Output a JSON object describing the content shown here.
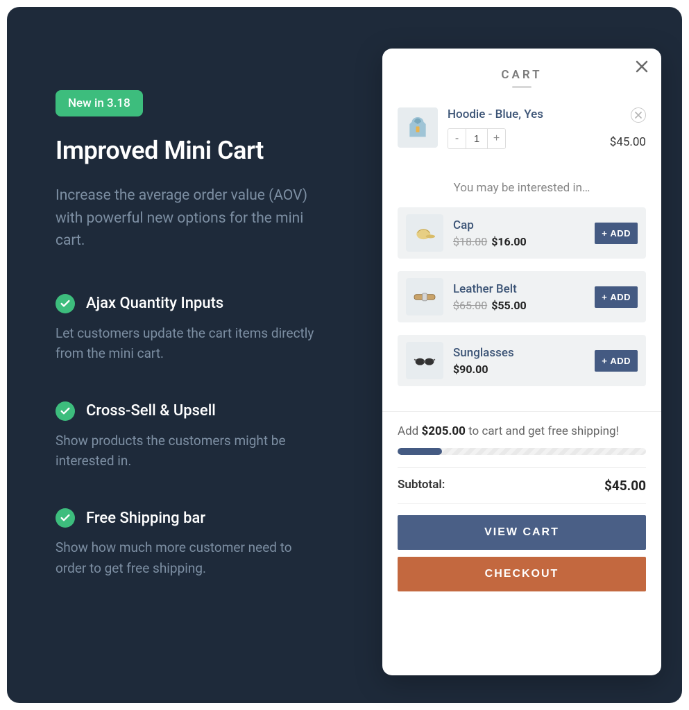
{
  "promo": {
    "badge": "New in 3.18",
    "headline": "Improved Mini Cart",
    "lead": "Increase the average order value (AOV) with powerful new options for the mini cart.",
    "features": [
      {
        "title": "Ajax Quantity Inputs",
        "desc": "Let customers update the cart items directly from the mini cart."
      },
      {
        "title": "Cross-Sell & Upsell",
        "desc": "Show products the customers might be interested in."
      },
      {
        "title": "Free Shipping bar",
        "desc": "Show how much more customer need to order to get free shipping."
      }
    ]
  },
  "cart": {
    "title": "CART",
    "item": {
      "name": "Hoodie - Blue, Yes",
      "qty": "1",
      "price": "$45.00"
    },
    "interested_label": "You may be interested in…",
    "recommendations": [
      {
        "name": "Cap",
        "old": "$18.00",
        "new": "$16.00",
        "add": "ADD"
      },
      {
        "name": "Leather Belt",
        "old": "$65.00",
        "new": "$55.00",
        "add": "ADD"
      },
      {
        "name": "Sunglasses",
        "old": "",
        "new": "$90.00",
        "add": "ADD"
      }
    ],
    "shipping": {
      "prefix": "Add ",
      "amount": "$205.00",
      "suffix": " to cart and get free shipping!",
      "progress_pct": 18
    },
    "subtotal_label": "Subtotal:",
    "subtotal": "$45.00",
    "view_cart": "VIEW CART",
    "checkout": "CHECKOUT"
  }
}
